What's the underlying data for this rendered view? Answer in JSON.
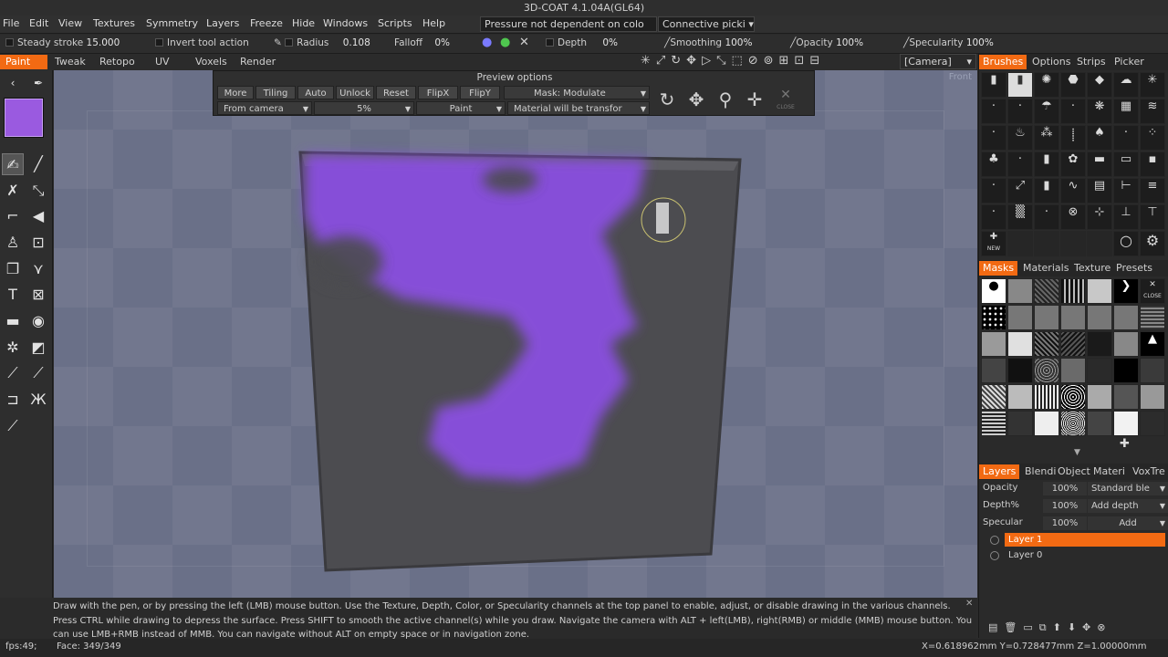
{
  "window": {
    "title": "3D-COAT 4.1.04A(GL64)"
  },
  "menu": [
    "File",
    "Edit",
    "View",
    "Textures",
    "Symmetry",
    "Layers",
    "Freeze",
    "Hide",
    "Windows",
    "Scripts",
    "Help"
  ],
  "menu_dropdowns": {
    "pressure": "Pressure not dependent on colo",
    "connective": "Connective picki"
  },
  "params": {
    "steady_stroke": "Steady stroke",
    "steady_stroke_value": "15.000",
    "invert_tool_action": "Invert tool action",
    "radius_label": "Radius",
    "radius_value": "0.108",
    "falloff_label": "Falloff",
    "falloff_value": "0%",
    "depth_label": "Depth",
    "depth_value": "0%",
    "smoothing_label": "Smoothing",
    "smoothing_value": "100%",
    "opacity_label": "Opacity",
    "opacity_value": "100%",
    "specularity_label": "Specularity",
    "specularity_value": "100%"
  },
  "camera_dropdown": "[Camera]",
  "room_tabs": [
    "Paint",
    "Tweak",
    "Retopo",
    "UV",
    "Voxels",
    "Render"
  ],
  "active_room": "Paint",
  "current_color": "#9a5ae0",
  "viewport": {
    "view_label": "Front"
  },
  "preview_options": {
    "title": "Preview options",
    "buttons": [
      "More",
      "Tiling",
      "Auto",
      "Unlock",
      "Reset",
      "FlipX",
      "FlipY"
    ],
    "mask_mode": "Mask: Modulate",
    "projection": "From camera",
    "percent": "5%",
    "paint_mode": "Paint",
    "material_mode": "Material will be transfor",
    "close_label": "CLOSE"
  },
  "brush_panel": {
    "tabs": [
      "Brushes",
      "Options",
      "Strips",
      "Picker"
    ],
    "new_label": "NEW"
  },
  "mask_panel": {
    "tabs": [
      "Masks",
      "Materials",
      "Texture",
      "Presets"
    ],
    "close_label": "CLOSE"
  },
  "layers_panel": {
    "tabs": [
      "Layers",
      "Blendi",
      "Object",
      "Materi",
      "VoxTre"
    ],
    "opacity_label": "Opacity",
    "opacity_value": "100%",
    "opacity_mode": "Standard ble",
    "depth_label": "Depth%",
    "depth_value": "100%",
    "depth_mode": "Add depth",
    "specular_label": "Specular",
    "specular_value": "100%",
    "specular_mode": "Add",
    "layers": [
      "Layer 1",
      "Layer 0"
    ],
    "active_layer": "Layer 1"
  },
  "hint_text": "Draw with the pen, or by pressing the left (LMB) mouse button. Use the Texture, Depth, Color, or Specularity channels at the top panel to enable, adjust, or disable drawing in the various channels. Press CTRL while drawing to depress the surface. Press SHIFT to smooth the active channel(s) while you draw. Navigate the camera with ALT + left(LMB), right(RMB) or middle (MMB) mouse button. You can use LMB+RMB instead of MMB. You can navigate without ALT on empty space or in navigation zone.",
  "status": {
    "fps": "fps:49;",
    "faces": "Face: 349/349",
    "coords": "X=0.618962mm Y=0.728477mm Z=1.00000mm"
  }
}
